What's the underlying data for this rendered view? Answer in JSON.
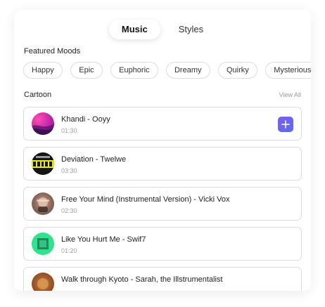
{
  "tabs": [
    {
      "label": "Music",
      "active": true
    },
    {
      "label": "Styles",
      "active": false
    }
  ],
  "featured_moods": {
    "label": "Featured Moods",
    "chips": [
      "Happy",
      "Epic",
      "Euphoric",
      "Dreamy",
      "Quirky",
      "Mysterious"
    ]
  },
  "cartoon": {
    "label": "Cartoon",
    "view_all": "View All",
    "tracks": [
      {
        "title": "Khandi - Ooyy",
        "duration": "01:30",
        "thumbnail": "gradient-blob-artwork"
      },
      {
        "title": "Deviation - Twelwe",
        "duration": "03:30",
        "thumbnail": "deviation-text-artwork"
      },
      {
        "title": "Free Your Mind (Instrumental Version) - Vicki Vox",
        "duration": "02:30",
        "thumbnail": "vicki-vox-artwork"
      },
      {
        "title": "Like You Hurt Me - Swif7",
        "duration": "01:20",
        "thumbnail": "green-square-artwork"
      },
      {
        "title": "Walk through Kyoto - Sarah, the Illstrumentalist",
        "duration": "",
        "thumbnail": "warm-artwork"
      }
    ]
  },
  "colors": {
    "accent": "#6a63f2",
    "chip_border": "#dcdcdc",
    "muted_text": "#a0a0a0"
  }
}
